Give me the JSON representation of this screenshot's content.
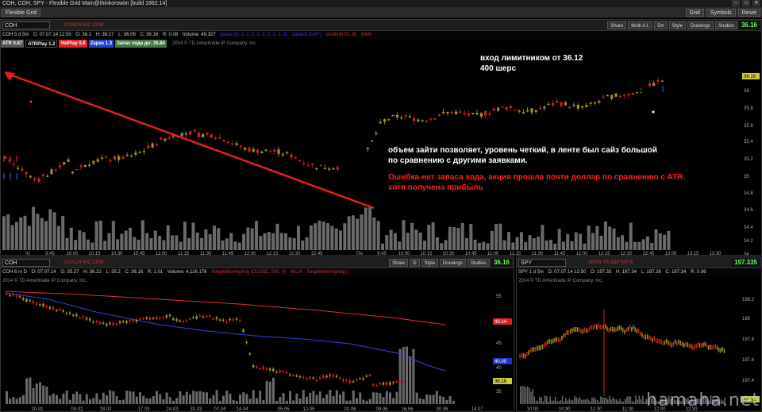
{
  "window": {
    "title": "COH, COH, SPY - Flexible Grid Main@thinkorswim [build 1862.14]",
    "tab": "Flexible Grid",
    "buttons": [
      "Grid",
      "Symbols",
      "Reset"
    ],
    "watermark": "hamaha.net"
  },
  "top_panel": {
    "symbol": "COH",
    "company": "COACH INC COM",
    "tools": [
      "Share",
      "think A.I.",
      "5m",
      "Style",
      "Drawings",
      "Studies"
    ],
    "last": "36.16",
    "info": {
      "series": "COH 5 d 5m",
      "date": "D: 07.07.14 12:50",
      "open": "O: 36.1",
      "high": "H: 36.17",
      "low": "L: 36.09",
      "close": "C: 36.16",
      "range": "R: 0.08",
      "volume": "Volume: 49,327",
      "study1": "pokaz (0, 1, 1, 1, 0, 1, 1, 1, 1, 1)",
      "study2": "zapas2 (DAY)",
      "study3": "ctrstkr(0.01, 8)",
      "study4": "NAN"
    },
    "badges": [
      {
        "text": "ATR 0.87",
        "color": "#555555"
      },
      {
        "text": "ATRPlay 1.2",
        "color": "#000000"
      },
      {
        "text": "VolPlay 0.6",
        "color": "#dd2222"
      },
      {
        "text": "Zapas 1.3",
        "color": "#2244cc"
      },
      {
        "text": "Запас хода до: 35.84",
        "color": "#447744"
      }
    ],
    "copyright": "2014 © TD Ameritrade IP Company, Inc.",
    "price_labels": [
      "36.16",
      "36",
      "35.8",
      "35.6",
      "35.4",
      "35.2",
      "35",
      "34.8",
      "34.6",
      "34.4",
      "34.2",
      "34"
    ],
    "time_labels": [
      "Чт",
      "9:45",
      "10:00",
      "10:15",
      "10:30",
      "10:45",
      "11:00",
      "11:15",
      "11:30",
      "11:45",
      "12:00",
      "12:15",
      "12:30",
      "12:45",
      "Пн",
      "9:45",
      "10:00",
      "10:15",
      "10:30",
      "10:45",
      "11:00",
      "11:15",
      "11:30",
      "11:45",
      "12:00",
      "12:15",
      "12:30",
      "12:45",
      "13:00",
      "13:15",
      "13:30"
    ]
  },
  "annotations": {
    "entry_line1": "вход лимитником от 36.12",
    "entry_line2": "400 шерс",
    "comment_line1": "объем зайти позволяет, уровень четкий, в ленте был сайз большой",
    "comment_line2": "по сравнению с другими заявками.",
    "error_line1": "Ошибка-нет запаса хода, акция прошла почти доллар по сравнению с ATR.",
    "error_line2": "хотя получена прибыль"
  },
  "bottom_left_panel": {
    "symbol": "COH",
    "company": "COACH INC COM",
    "tools": [
      "Share",
      "D",
      "Style",
      "Drawings",
      "Studies"
    ],
    "last": "36.16",
    "info": {
      "series": "COH 6 m D",
      "date": "D: 07.07.14",
      "open": "O: 35.27",
      "high": "H: 36.21",
      "low": "L: 35.2",
      "close": "C: 36.16",
      "range": "R: 1.01",
      "volume": "Volume: 4,116,176",
      "sma1": "SimpleMovingAvg (CLOSE, 200, 0)",
      "sma1_val": "49.14",
      "sma2": "SimpleMovingAvg ("
    },
    "copyright": "2014 © TD Ameritrade IP Company, Inc.",
    "price_labels": [
      "55",
      "50",
      "45",
      "40",
      "35"
    ],
    "flags": [
      "49.14",
      "40.09",
      "36.16"
    ],
    "time_labels": [
      "20.01",
      "03.02",
      "18.02",
      "17.03",
      "24.03",
      "31.03",
      "07.04",
      "14.04",
      "05.05",
      "12.05",
      "02.06",
      "09.06",
      "16.06",
      "30.06",
      "14.07"
    ]
  },
  "bottom_right_panel": {
    "symbol": "SPY",
    "company": "SPDR TR S&P 500 E",
    "last": "197.335",
    "info": {
      "series": "SPY 1 d 5m",
      "date": "D: 07.07.14 12:50",
      "open": "O: 197.33",
      "high": "H: 197.34",
      "low": "L: 197.28",
      "close": "C: 197.34",
      "range": "R: 0.06"
    },
    "copyright": "2014 © TD Ameritrade IP Company, Inc.",
    "price_labels": [
      "198.2",
      "198",
      "197.8",
      "197.6",
      "197.4"
    ],
    "flag": "197.34",
    "time_labels": [
      "10:00",
      "10:30",
      "11:00",
      "11:30",
      "12:00",
      "12:30"
    ]
  }
}
